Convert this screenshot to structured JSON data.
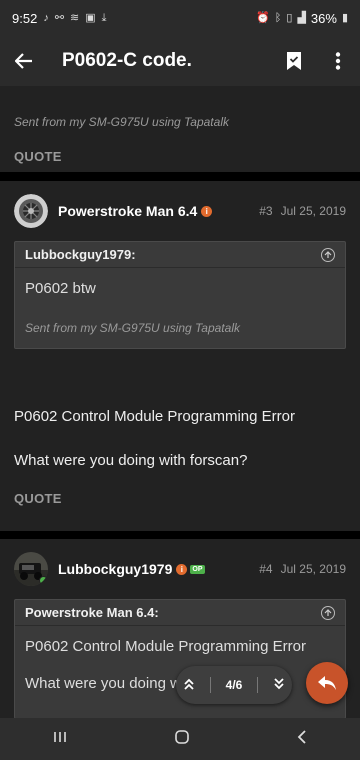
{
  "status_bar": {
    "time": "9:52",
    "battery": "36%"
  },
  "app_bar": {
    "title": "P0602-C  code."
  },
  "post_top": {
    "signature": "Sent from my SM-G975U using Tapatalk",
    "quote_label": "QUOTE"
  },
  "post3": {
    "username": "Powerstroke Man 6.4",
    "number": "#3",
    "date": "Jul 25, 2019",
    "quote_author": "Lubbockguy1979:",
    "quote_text": "P0602 btw",
    "quote_signature": "Sent from my SM-G975U using Tapatalk",
    "body_line1": "P0602 Control Module Programming Error",
    "body_line2": "What were you doing with forscan?",
    "quote_label": "QUOTE"
  },
  "post4": {
    "username": "Lubbockguy1979",
    "op_badge": "OP",
    "number": "#4",
    "date": "Jul 25, 2019",
    "quote_author": "Powerstroke Man 6.4:",
    "quote_line1": "P0602 Control Module Programming Error",
    "quote_line2": "What were you doing wi"
  },
  "pager": {
    "label": "4/6"
  },
  "colors": {
    "accent": "#c8532a",
    "badge": "#e26b2e",
    "op": "#4db04a"
  }
}
